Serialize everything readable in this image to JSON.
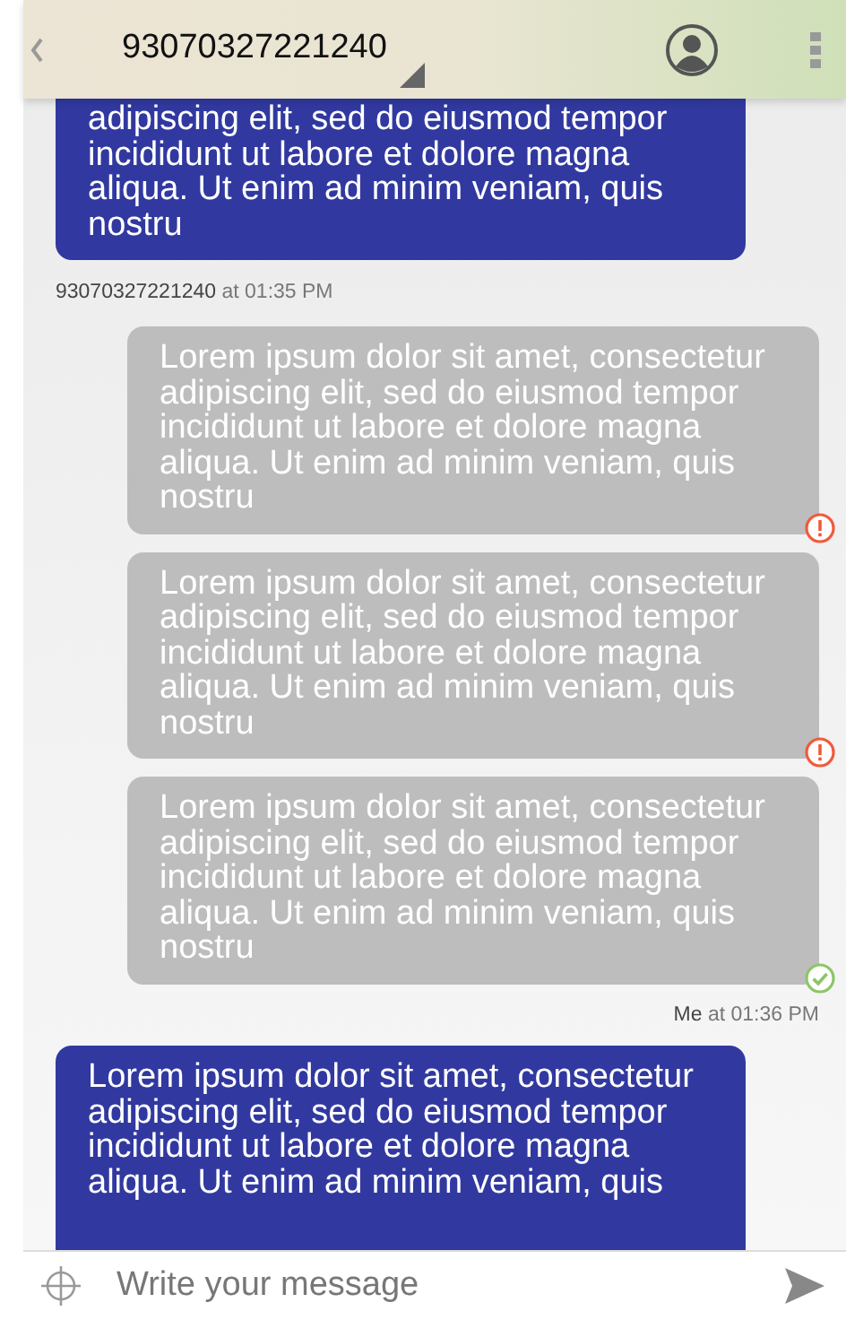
{
  "header": {
    "title": "93070327221240"
  },
  "messages": [
    {
      "kind": "bubble",
      "outgoing": false,
      "text": "adipiscing elit, sed do eiusmod tempor incididunt ut labore et dolore magna aliqua. Ut enim ad minim veniam, quis nostru"
    },
    {
      "kind": "meta",
      "outgoing": false,
      "sender": "93070327221240",
      "time": "at 01:35 PM"
    },
    {
      "kind": "bubble",
      "outgoing": true,
      "failed": true,
      "delivered": false,
      "text": "Lorem ipsum dolor sit amet, consectetur adipiscing elit, sed do eiusmod tempor incididunt ut labore et dolore magna aliqua. Ut enim ad minim veniam, quis nostru"
    },
    {
      "kind": "bubble",
      "outgoing": true,
      "failed": true,
      "delivered": false,
      "text": "Lorem ipsum dolor sit amet, consectetur adipiscing elit, sed do eiusmod tempor incididunt ut labore et dolore magna aliqua. Ut enim ad minim veniam, quis nostru"
    },
    {
      "kind": "bubble",
      "outgoing": true,
      "failed": false,
      "delivered": true,
      "text": "Lorem ipsum dolor sit amet, consectetur adipiscing elit, sed do eiusmod tempor incididunt ut labore et dolore magna aliqua. Ut enim ad minim veniam, quis nostru"
    },
    {
      "kind": "meta",
      "outgoing": true,
      "sender": "Me",
      "time": "at 01:36 PM"
    },
    {
      "kind": "bubble",
      "outgoing": false,
      "text": "Lorem ipsum dolor sit amet, consectetur adipiscing elit, sed do eiusmod tempor incididunt ut labore et dolore magna aliqua. Ut enim ad minim veniam, quis"
    }
  ],
  "composer": {
    "placeholder": "Write your message"
  }
}
